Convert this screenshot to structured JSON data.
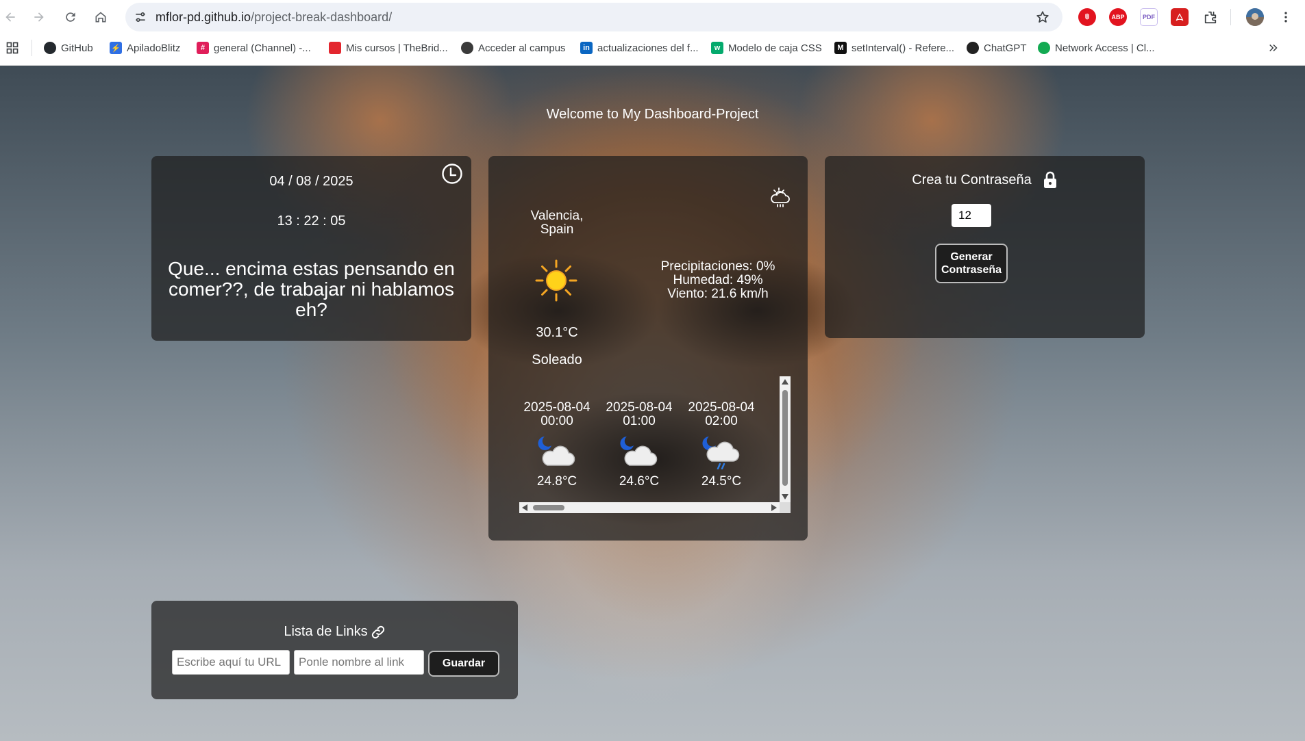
{
  "browser": {
    "url_host": "mflor-pd.github.io",
    "url_path": "/project-break-dashboard/",
    "extensions": [
      "adblock-icon",
      "abp-icon",
      "pdf-icon",
      "acrobat-icon",
      "extensions-icon"
    ],
    "abp_label": "ABP",
    "pdf_label": "PDF"
  },
  "bookmarks": [
    {
      "label": "GitHub",
      "icon": "github-icon",
      "color": "#24292e"
    },
    {
      "label": "ApiladoBlitz",
      "icon": "lightning-icon",
      "color": "#2f6fe4"
    },
    {
      "label": "general (Channel) -...",
      "icon": "slack-icon",
      "color": "#e01e5a"
    },
    {
      "label": "Mis cursos | TheBrid...",
      "icon": "thebridge-icon",
      "color": "#e3262e"
    },
    {
      "label": "Acceder al campus",
      "icon": "campus-icon",
      "color": "#3a3a3a"
    },
    {
      "label": "actualizaciones del f...",
      "icon": "linkedin-icon",
      "color": "#0a66c2"
    },
    {
      "label": "Modelo de caja CSS",
      "icon": "w3schools-icon",
      "color": "#04aa6d"
    },
    {
      "label": "setInterval() - Refere...",
      "icon": "mdn-icon",
      "color": "#111111"
    },
    {
      "label": "ChatGPT",
      "icon": "chatgpt-icon",
      "color": "#222222"
    },
    {
      "label": "Network Access | Cl...",
      "icon": "mongodb-icon",
      "color": "#13aa52"
    }
  ],
  "page": {
    "welcome": "Welcome to My Dashboard-Project"
  },
  "clock": {
    "date": "04 / 08 / 2025",
    "time": "13 : 22 : 05",
    "phrase": "Que... encima estas pensando en comer??, de trabajar ni hablamos eh?"
  },
  "weather": {
    "city": "Valencia, Spain",
    "temperature": "30.1°C",
    "condition": "Soleado",
    "precipitation": "Precipitaciones: 0%",
    "humidity": "Humedad: 49%",
    "wind": "Viento: 21.6 km/h",
    "forecast": [
      {
        "date": "2025-08-04",
        "hour": "00:00",
        "temp": "24.8°C",
        "icon": "night-cloud-icon"
      },
      {
        "date": "2025-08-04",
        "hour": "01:00",
        "temp": "24.6°C",
        "icon": "night-cloud-icon"
      },
      {
        "date": "2025-08-04",
        "hour": "02:00",
        "temp": "24.5°C",
        "icon": "night-rain-icon"
      }
    ]
  },
  "password": {
    "title": "Crea tu Contraseña",
    "length_value": "12",
    "button_label": "Generar Contraseña"
  },
  "links": {
    "title": "Lista de Links",
    "url_placeholder": "Escribe aquí tu URL",
    "name_placeholder": "Ponle nombre al link",
    "button_label": "Guardar"
  }
}
